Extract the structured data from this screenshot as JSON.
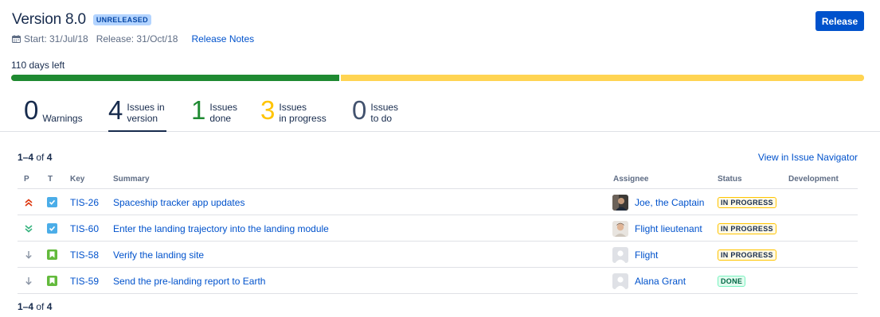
{
  "version": {
    "title": "Version 8.0",
    "status_badge": "UNRELEASED",
    "start": "Start: 31/Jul/18",
    "release": "Release: 31/Oct/18",
    "release_notes_link": "Release Notes",
    "release_button": "Release",
    "days_left": "110 days left",
    "progress": {
      "done_fraction": 0.385,
      "in_progress_fraction": 0.615,
      "done_color": "#1F8A32",
      "in_progress_color": "#FFD452"
    }
  },
  "stats": [
    {
      "num": "0",
      "line1": "Warnings",
      "line2": "",
      "color": "#172B4D"
    },
    {
      "num": "4",
      "line1": "Issues in",
      "line2": "version",
      "color": "#172B4D"
    },
    {
      "num": "1",
      "line1": "Issues",
      "line2": "done",
      "color": "#1F8A32"
    },
    {
      "num": "3",
      "line1": "Issues",
      "line2": "in progress",
      "color": "#FFC400"
    },
    {
      "num": "0",
      "line1": "Issues",
      "line2": "to do",
      "color": "#42526E"
    }
  ],
  "list": {
    "count_range": "1–4",
    "count_of": "of",
    "count_total": "4",
    "view_link": "View in Issue Navigator",
    "columns": {
      "p": "P",
      "t": "T",
      "key": "Key",
      "summary": "Summary",
      "assignee": "Assignee",
      "status": "Status",
      "development": "Development"
    },
    "rows": [
      {
        "priority": "highest",
        "type": "task",
        "key": "TIS-26",
        "summary": "Spaceship tracker app updates",
        "assignee": "Joe, the Captain",
        "avatar": "photo-dark",
        "status": "IN PROGRESS",
        "status_kind": "progress"
      },
      {
        "priority": "lowest",
        "type": "task",
        "key": "TIS-60",
        "summary": "Enter the landing trajectory into the landing module",
        "assignee": "Flight lieutenant",
        "avatar": "photo-light",
        "status": "IN PROGRESS",
        "status_kind": "progress"
      },
      {
        "priority": "low",
        "type": "story",
        "key": "TIS-58",
        "summary": "Verify the landing site",
        "assignee": "Flight",
        "avatar": "default",
        "status": "IN PROGRESS",
        "status_kind": "progress"
      },
      {
        "priority": "low",
        "type": "story",
        "key": "TIS-59",
        "summary": "Send the pre-landing report to Earth",
        "assignee": "Alana Grant",
        "avatar": "default",
        "status": "DONE",
        "status_kind": "done"
      }
    ]
  }
}
